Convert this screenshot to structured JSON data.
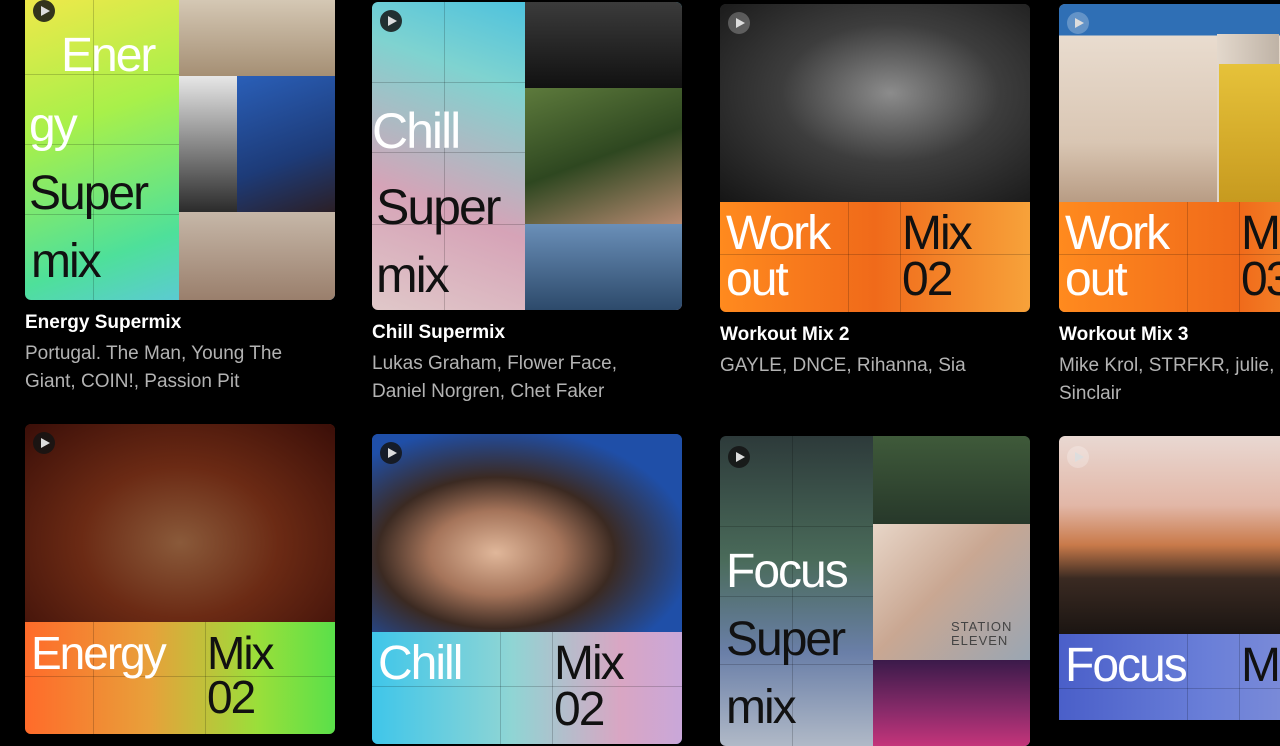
{
  "row1": [
    {
      "title": "Energy Supermix",
      "artists_line1": "Portugal. The Man, Young The",
      "artists_line2": "Giant, COIN!, Passion Pit",
      "art_words": [
        "Ener",
        "gy",
        "Super",
        "mix"
      ]
    },
    {
      "title": "Chill Supermix",
      "artists_line1": "Lukas Graham, Flower Face,",
      "artists_line2": "Daniel Norgren, Chet Faker",
      "art_words": [
        "Chill",
        "Super",
        "mix"
      ]
    },
    {
      "title": "Workout Mix 2",
      "artists_line1": "GAYLE, DNCE, Rihanna, Sia",
      "artists_line2": "",
      "art_words": [
        "Work",
        "out",
        "Mix",
        "02"
      ]
    },
    {
      "title": "Workout Mix 3",
      "artists_line1": "Mike Krol, STRFKR, julie,",
      "artists_line2": "Sinclair",
      "art_words": [
        "Work",
        "out",
        "M",
        "03"
      ]
    }
  ],
  "row2": [
    {
      "art_words": [
        "Energy",
        "Mix",
        "02"
      ]
    },
    {
      "art_words": [
        "Chill",
        "Mix",
        "02"
      ]
    },
    {
      "art_words": [
        "Focus",
        "Super",
        "mix"
      ],
      "poster_title": "STATION ELEVEN"
    },
    {
      "art_words": [
        "Focus",
        "M"
      ]
    }
  ],
  "colors": {
    "background": "#000000",
    "title": "#ffffff",
    "subtitle": "#b3b3b3"
  }
}
